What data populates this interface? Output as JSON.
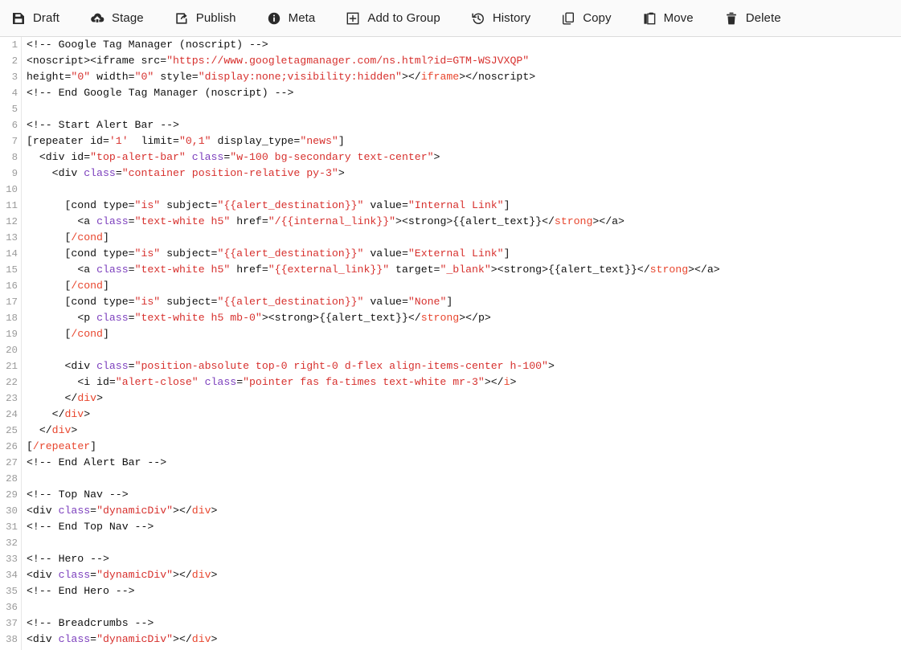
{
  "toolbar": {
    "items": [
      {
        "label": "Draft",
        "icon": "save-icon",
        "name": "toolbar-item-draft"
      },
      {
        "label": "Stage",
        "icon": "cloud-upload-icon",
        "name": "toolbar-item-stage"
      },
      {
        "label": "Publish",
        "icon": "share-square-icon",
        "name": "toolbar-item-publish"
      },
      {
        "label": "Meta",
        "icon": "info-circle-icon",
        "name": "toolbar-item-meta"
      },
      {
        "label": "Add to Group",
        "icon": "plus-square-icon",
        "name": "toolbar-item-add-to-group"
      },
      {
        "label": "History",
        "icon": "history-icon",
        "name": "toolbar-item-history"
      },
      {
        "label": "Copy",
        "icon": "copy-icon",
        "name": "toolbar-item-copy"
      },
      {
        "label": "Move",
        "icon": "paste-icon",
        "name": "toolbar-item-move"
      },
      {
        "label": "Delete",
        "icon": "trash-icon",
        "name": "toolbar-item-delete"
      }
    ]
  },
  "colors": {
    "toolbar_bg": "#fafafa",
    "toolbar_border": "#dcdcdc",
    "editor_bg": "#ffffff",
    "gutter_text": "#9a9a9a",
    "code_text": "#111111",
    "string": "#d7312e",
    "attribute": "#7c3fbd",
    "closing_tag": "#e8462e"
  },
  "editor": {
    "first_line": 1,
    "last_line": 38,
    "language": "html",
    "lines": [
      {
        "n": 1,
        "tokens": [
          {
            "t": "cmt",
            "v": "<!-- Google Tag Manager (noscript) -->"
          }
        ]
      },
      {
        "n": 2,
        "tokens": [
          {
            "t": "tag",
            "v": "<noscript><iframe src="
          },
          {
            "t": "str",
            "v": "\"https://www.googletagmanager.com/ns.html?id=GTM-WSJVXQP\""
          }
        ]
      },
      {
        "n": 3,
        "tokens": [
          {
            "t": "tag",
            "v": "height="
          },
          {
            "t": "str",
            "v": "\"0\""
          },
          {
            "t": "tag",
            "v": " width="
          },
          {
            "t": "str",
            "v": "\"0\""
          },
          {
            "t": "tag",
            "v": " style="
          },
          {
            "t": "str",
            "v": "\"display:none;visibility:hidden\""
          },
          {
            "t": "tag",
            "v": "></"
          },
          {
            "t": "ctag",
            "v": "iframe"
          },
          {
            "t": "tag",
            "v": "></"
          },
          {
            "t": "tag",
            "v": "noscript>"
          }
        ]
      },
      {
        "n": 4,
        "tokens": [
          {
            "t": "cmt",
            "v": "<!-- End Google Tag Manager (noscript) -->"
          }
        ]
      },
      {
        "n": 5,
        "tokens": []
      },
      {
        "n": 6,
        "tokens": [
          {
            "t": "cmt",
            "v": "<!-- Start Alert Bar -->"
          }
        ]
      },
      {
        "n": 7,
        "tokens": [
          {
            "t": "plain",
            "v": "[repeater id="
          },
          {
            "t": "str",
            "v": "'1'"
          },
          {
            "t": "plain",
            "v": "  limit="
          },
          {
            "t": "str",
            "v": "\"0,1\""
          },
          {
            "t": "plain",
            "v": " display_type="
          },
          {
            "t": "str",
            "v": "\"news\""
          },
          {
            "t": "plain",
            "v": "]"
          }
        ]
      },
      {
        "n": 8,
        "tokens": [
          {
            "t": "plain",
            "v": "  "
          },
          {
            "t": "tag",
            "v": "<div id="
          },
          {
            "t": "str",
            "v": "\"top-alert-bar\""
          },
          {
            "t": "tag",
            "v": " "
          },
          {
            "t": "attr",
            "v": "class"
          },
          {
            "t": "tag",
            "v": "="
          },
          {
            "t": "str",
            "v": "\"w-100 bg-secondary text-center\""
          },
          {
            "t": "tag",
            "v": ">"
          }
        ]
      },
      {
        "n": 9,
        "tokens": [
          {
            "t": "plain",
            "v": "    "
          },
          {
            "t": "tag",
            "v": "<div "
          },
          {
            "t": "attr",
            "v": "class"
          },
          {
            "t": "tag",
            "v": "="
          },
          {
            "t": "str",
            "v": "\"container position-relative py-3\""
          },
          {
            "t": "tag",
            "v": ">"
          }
        ]
      },
      {
        "n": 10,
        "tokens": []
      },
      {
        "n": 11,
        "tokens": [
          {
            "t": "plain",
            "v": "      [cond type="
          },
          {
            "t": "str",
            "v": "\"is\""
          },
          {
            "t": "plain",
            "v": " subject="
          },
          {
            "t": "str",
            "v": "\"{{alert_destination}}\""
          },
          {
            "t": "plain",
            "v": " value="
          },
          {
            "t": "str",
            "v": "\"Internal Link\""
          },
          {
            "t": "plain",
            "v": "]"
          }
        ]
      },
      {
        "n": 12,
        "tokens": [
          {
            "t": "plain",
            "v": "        "
          },
          {
            "t": "tag",
            "v": "<a "
          },
          {
            "t": "attr",
            "v": "class"
          },
          {
            "t": "tag",
            "v": "="
          },
          {
            "t": "str",
            "v": "\"text-white h5\""
          },
          {
            "t": "tag",
            "v": " href="
          },
          {
            "t": "str",
            "v": "\"/{{internal_link}}\""
          },
          {
            "t": "tag",
            "v": "><strong>{{alert_text}}</"
          },
          {
            "t": "ctag",
            "v": "strong"
          },
          {
            "t": "tag",
            "v": "></"
          },
          {
            "t": "tag",
            "v": "a>"
          }
        ]
      },
      {
        "n": 13,
        "tokens": [
          {
            "t": "plain",
            "v": "      ["
          },
          {
            "t": "ctag",
            "v": "/cond"
          },
          {
            "t": "plain",
            "v": "]"
          }
        ]
      },
      {
        "n": 14,
        "tokens": [
          {
            "t": "plain",
            "v": "      [cond type="
          },
          {
            "t": "str",
            "v": "\"is\""
          },
          {
            "t": "plain",
            "v": " subject="
          },
          {
            "t": "str",
            "v": "\"{{alert_destination}}\""
          },
          {
            "t": "plain",
            "v": " value="
          },
          {
            "t": "str",
            "v": "\"External Link\""
          },
          {
            "t": "plain",
            "v": "]"
          }
        ]
      },
      {
        "n": 15,
        "tokens": [
          {
            "t": "plain",
            "v": "        "
          },
          {
            "t": "tag",
            "v": "<a "
          },
          {
            "t": "attr",
            "v": "class"
          },
          {
            "t": "tag",
            "v": "="
          },
          {
            "t": "str",
            "v": "\"text-white h5\""
          },
          {
            "t": "tag",
            "v": " href="
          },
          {
            "t": "str",
            "v": "\"{{external_link}}\""
          },
          {
            "t": "tag",
            "v": " target="
          },
          {
            "t": "str",
            "v": "\"_blank\""
          },
          {
            "t": "tag",
            "v": "><strong>{{alert_text}}</"
          },
          {
            "t": "ctag",
            "v": "strong"
          },
          {
            "t": "tag",
            "v": "></"
          },
          {
            "t": "tag",
            "v": "a>"
          }
        ]
      },
      {
        "n": 16,
        "tokens": [
          {
            "t": "plain",
            "v": "      ["
          },
          {
            "t": "ctag",
            "v": "/cond"
          },
          {
            "t": "plain",
            "v": "]"
          }
        ]
      },
      {
        "n": 17,
        "tokens": [
          {
            "t": "plain",
            "v": "      [cond type="
          },
          {
            "t": "str",
            "v": "\"is\""
          },
          {
            "t": "plain",
            "v": " subject="
          },
          {
            "t": "str",
            "v": "\"{{alert_destination}}\""
          },
          {
            "t": "plain",
            "v": " value="
          },
          {
            "t": "str",
            "v": "\"None\""
          },
          {
            "t": "plain",
            "v": "]"
          }
        ]
      },
      {
        "n": 18,
        "tokens": [
          {
            "t": "plain",
            "v": "        "
          },
          {
            "t": "tag",
            "v": "<p "
          },
          {
            "t": "attr",
            "v": "class"
          },
          {
            "t": "tag",
            "v": "="
          },
          {
            "t": "str",
            "v": "\"text-white h5 mb-0\""
          },
          {
            "t": "tag",
            "v": "><strong>{{alert_text}}</"
          },
          {
            "t": "ctag",
            "v": "strong"
          },
          {
            "t": "tag",
            "v": "></"
          },
          {
            "t": "tag",
            "v": "p>"
          }
        ]
      },
      {
        "n": 19,
        "tokens": [
          {
            "t": "plain",
            "v": "      ["
          },
          {
            "t": "ctag",
            "v": "/cond"
          },
          {
            "t": "plain",
            "v": "]"
          }
        ]
      },
      {
        "n": 20,
        "tokens": []
      },
      {
        "n": 21,
        "tokens": [
          {
            "t": "plain",
            "v": "      "
          },
          {
            "t": "tag",
            "v": "<div "
          },
          {
            "t": "attr",
            "v": "class"
          },
          {
            "t": "tag",
            "v": "="
          },
          {
            "t": "str",
            "v": "\"position-absolute top-0 right-0 d-flex align-items-center h-100\""
          },
          {
            "t": "tag",
            "v": ">"
          }
        ]
      },
      {
        "n": 22,
        "tokens": [
          {
            "t": "plain",
            "v": "        "
          },
          {
            "t": "tag",
            "v": "<i id="
          },
          {
            "t": "str",
            "v": "\"alert-close\""
          },
          {
            "t": "tag",
            "v": " "
          },
          {
            "t": "attr",
            "v": "class"
          },
          {
            "t": "tag",
            "v": "="
          },
          {
            "t": "str",
            "v": "\"pointer fas fa-times text-white mr-3\""
          },
          {
            "t": "tag",
            "v": "></"
          },
          {
            "t": "ctag",
            "v": "i"
          },
          {
            "t": "tag",
            "v": ">"
          }
        ]
      },
      {
        "n": 23,
        "tokens": [
          {
            "t": "plain",
            "v": "      "
          },
          {
            "t": "tag",
            "v": "</"
          },
          {
            "t": "ctag",
            "v": "div"
          },
          {
            "t": "tag",
            "v": ">"
          }
        ]
      },
      {
        "n": 24,
        "tokens": [
          {
            "t": "plain",
            "v": "    "
          },
          {
            "t": "tag",
            "v": "</"
          },
          {
            "t": "ctag",
            "v": "div"
          },
          {
            "t": "tag",
            "v": ">"
          }
        ]
      },
      {
        "n": 25,
        "tokens": [
          {
            "t": "plain",
            "v": "  "
          },
          {
            "t": "tag",
            "v": "</"
          },
          {
            "t": "ctag",
            "v": "div"
          },
          {
            "t": "tag",
            "v": ">"
          }
        ]
      },
      {
        "n": 26,
        "tokens": [
          {
            "t": "plain",
            "v": "["
          },
          {
            "t": "ctag",
            "v": "/repeater"
          },
          {
            "t": "plain",
            "v": "]"
          }
        ]
      },
      {
        "n": 27,
        "tokens": [
          {
            "t": "cmt",
            "v": "<!-- End Alert Bar -->"
          }
        ]
      },
      {
        "n": 28,
        "tokens": []
      },
      {
        "n": 29,
        "tokens": [
          {
            "t": "cmt",
            "v": "<!-- Top Nav -->"
          }
        ]
      },
      {
        "n": 30,
        "tokens": [
          {
            "t": "tag",
            "v": "<div "
          },
          {
            "t": "attr",
            "v": "class"
          },
          {
            "t": "tag",
            "v": "="
          },
          {
            "t": "str",
            "v": "\"dynamicDiv\""
          },
          {
            "t": "tag",
            "v": "></"
          },
          {
            "t": "ctag",
            "v": "div"
          },
          {
            "t": "tag",
            "v": ">"
          }
        ]
      },
      {
        "n": 31,
        "tokens": [
          {
            "t": "cmt",
            "v": "<!-- End Top Nav -->"
          }
        ]
      },
      {
        "n": 32,
        "tokens": []
      },
      {
        "n": 33,
        "tokens": [
          {
            "t": "cmt",
            "v": "<!-- Hero -->"
          }
        ]
      },
      {
        "n": 34,
        "tokens": [
          {
            "t": "tag",
            "v": "<div "
          },
          {
            "t": "attr",
            "v": "class"
          },
          {
            "t": "tag",
            "v": "="
          },
          {
            "t": "str",
            "v": "\"dynamicDiv\""
          },
          {
            "t": "tag",
            "v": "></"
          },
          {
            "t": "ctag",
            "v": "div"
          },
          {
            "t": "tag",
            "v": ">"
          }
        ]
      },
      {
        "n": 35,
        "tokens": [
          {
            "t": "cmt",
            "v": "<!-- End Hero -->"
          }
        ]
      },
      {
        "n": 36,
        "tokens": []
      },
      {
        "n": 37,
        "tokens": [
          {
            "t": "cmt",
            "v": "<!-- Breadcrumbs -->"
          }
        ]
      },
      {
        "n": 38,
        "tokens": [
          {
            "t": "tag",
            "v": "<div "
          },
          {
            "t": "attr",
            "v": "class"
          },
          {
            "t": "tag",
            "v": "="
          },
          {
            "t": "str",
            "v": "\"dynamicDiv\""
          },
          {
            "t": "tag",
            "v": "></"
          },
          {
            "t": "ctag",
            "v": "div"
          },
          {
            "t": "tag",
            "v": ">"
          }
        ]
      }
    ]
  }
}
